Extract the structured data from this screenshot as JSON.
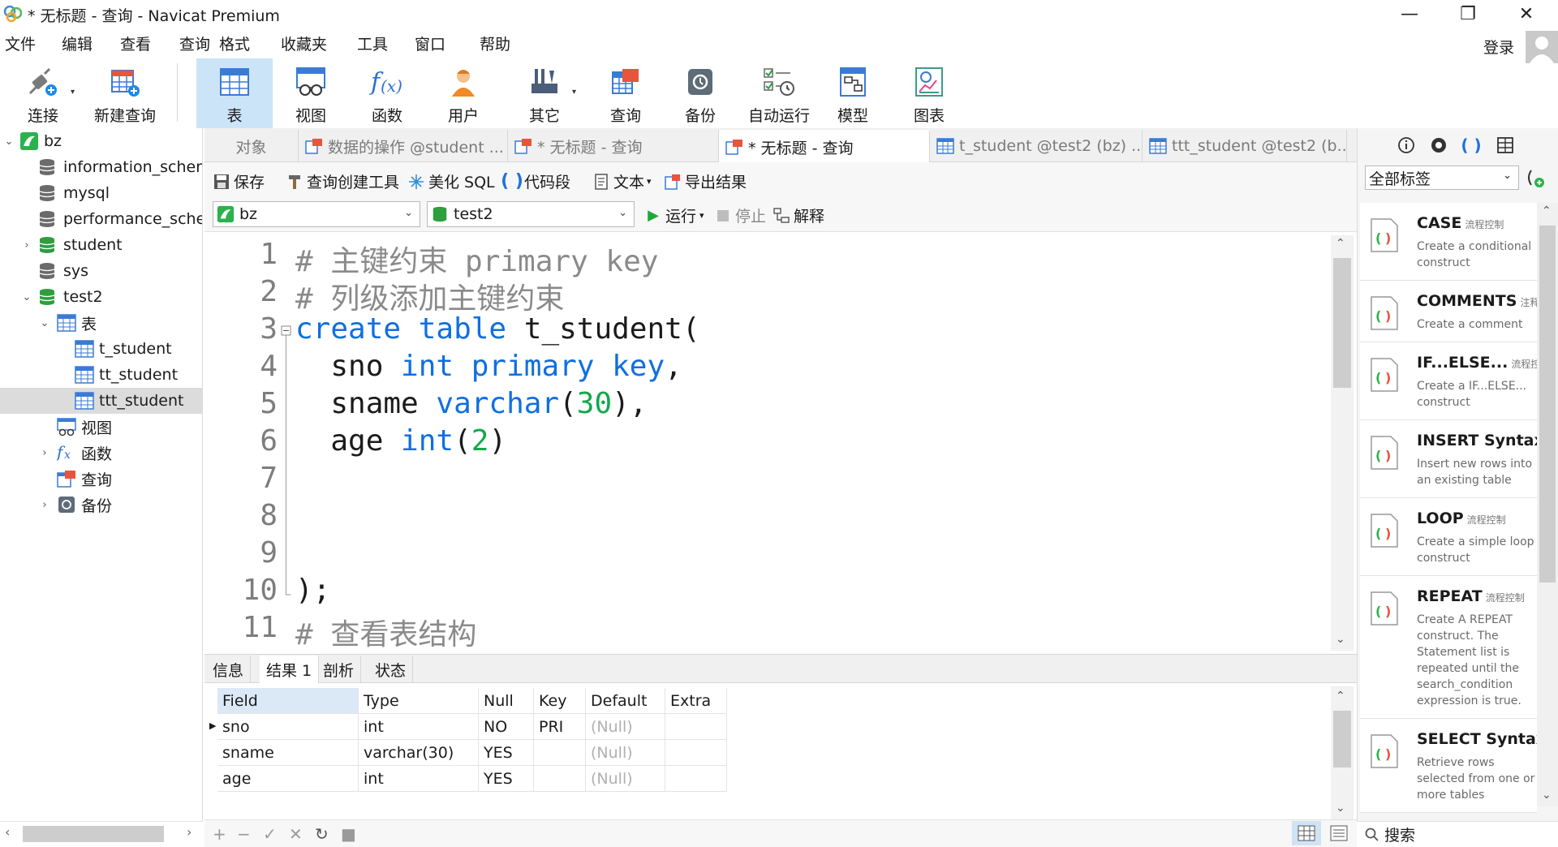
{
  "window": {
    "title": "* 无标题 - 查询 - Navicat Premium",
    "minimize": "—",
    "maximize": "❐",
    "close": "✕"
  },
  "menu": [
    "文件",
    "编辑",
    "查看",
    "查询",
    "格式",
    "收藏夹",
    "工具",
    "窗口",
    "帮助"
  ],
  "account": {
    "login": "登录"
  },
  "toolbar": {
    "connect": "连接",
    "new_query": "新建查询",
    "table": "表",
    "view": "视图",
    "function": "函数",
    "user": "用户",
    "other": "其它",
    "query": "查询",
    "backup": "备份",
    "automation": "自动运行",
    "model": "模型",
    "chart": "图表"
  },
  "navigator": {
    "connection": "bz",
    "databases": [
      "information_schem",
      "mysql",
      "performance_schei",
      "student",
      "sys",
      "test2"
    ],
    "test2_children": {
      "tables_folder": "表",
      "tables": [
        "t_student",
        "tt_student",
        "ttt_student"
      ],
      "views": "视图",
      "functions": "函数",
      "queries": "查询",
      "backups": "备份"
    }
  },
  "tabs": [
    {
      "label": "对象"
    },
    {
      "label": "数据的操作 @student ..."
    },
    {
      "label": "* 无标题 - 查询"
    },
    {
      "label": "* 无标题 - 查询"
    },
    {
      "label": "t_student @test2 (bz) ..."
    },
    {
      "label": "ttt_student @test2 (b..."
    }
  ],
  "editor_toolbar": {
    "save": "保存",
    "query_builder": "查询创建工具",
    "beautify": "美化 SQL",
    "snippet": "代码段",
    "text": "文本",
    "export": "导出结果"
  },
  "runbar": {
    "connection": "bz",
    "database": "test2",
    "run": "运行",
    "stop": "停止",
    "explain": "解释"
  },
  "code": {
    "line_numbers": [
      "1",
      "2",
      "3",
      "4",
      "5",
      "6",
      "7",
      "8",
      "9",
      "10",
      "11"
    ],
    "l1": "# 主键约束 primary key",
    "l2": "# 列级添加主键约束",
    "l3_kw": "create table",
    "l3_rest": " t_student(",
    "l4_col": "  sno ",
    "l4_kw": "int primary key",
    "l4_end": ",",
    "l5_col": "  sname ",
    "l5_kw": "varchar",
    "l5_open": "(",
    "l5_num": "30",
    "l5_end": "),",
    "l6_col": "  age ",
    "l6_kw": "int",
    "l6_open": "(",
    "l6_num": "2",
    "l6_end": ")",
    "l10": ");",
    "l11": "# 查看表结构"
  },
  "result_tabs": [
    "信息",
    "结果 1",
    "剖析",
    "状态"
  ],
  "grid": {
    "columns": [
      "Field",
      "Type",
      "Null",
      "Key",
      "Default",
      "Extra"
    ],
    "rows": [
      [
        "sno",
        "int",
        "NO",
        "PRI",
        "(Null)",
        ""
      ],
      [
        "sname",
        "varchar(30)",
        "YES",
        "",
        "(Null)",
        ""
      ],
      [
        "age",
        "int",
        "YES",
        "",
        "(Null)",
        ""
      ]
    ]
  },
  "status_buttons": [
    "+",
    "−",
    "✓",
    "✕",
    "↻",
    "■"
  ],
  "right_panel": {
    "tag_filter": "全部标签",
    "snippets": [
      {
        "title": "CASE",
        "tag": "流程控制",
        "desc": "Create a conditional construct"
      },
      {
        "title": "COMMENTS",
        "tag": "注释",
        "desc": "Create a comment"
      },
      {
        "title": "IF...ELSE...",
        "tag": "流程控制",
        "desc": "Create a IF...ELSE... construct"
      },
      {
        "title": "INSERT Syntax",
        "tag": "",
        "desc": "Insert new rows into an existing table"
      },
      {
        "title": "LOOP",
        "tag": "流程控制",
        "desc": "Create a simple loop construct"
      },
      {
        "title": "REPEAT",
        "tag": "流程控制",
        "desc": "Create A REPEAT construct. The Statement list is repeated until the search_condition expression is true."
      },
      {
        "title": "SELECT Syntax",
        "tag": "",
        "desc": "Retrieve rows selected from one or more tables"
      }
    ],
    "search": "搜索"
  },
  "colors": {
    "keyword": "#0f6fe0",
    "number": "#12a84a",
    "comment": "#8a8a8a",
    "active_tool": "#cce4f7"
  }
}
